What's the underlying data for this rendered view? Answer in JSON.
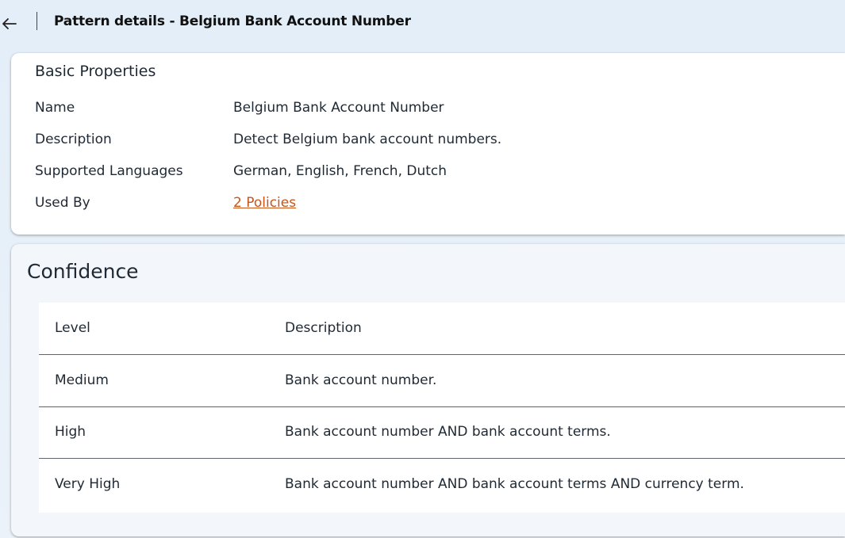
{
  "header": {
    "title": "Pattern details - Belgium Bank Account Number"
  },
  "basic": {
    "title": "Basic Properties",
    "rows": [
      {
        "label": "Name",
        "value": "Belgium Bank Account Number"
      },
      {
        "label": "Description",
        "value": "Detect Belgium bank account numbers."
      },
      {
        "label": "Supported Languages",
        "value": "German, English, French, Dutch"
      },
      {
        "label": "Used By",
        "value": "2 Policies"
      }
    ]
  },
  "confidence": {
    "title": "Confidence",
    "columns": {
      "level": "Level",
      "description": "Description"
    },
    "rows": [
      {
        "level": "Medium",
        "description": "Bank account number."
      },
      {
        "level": "High",
        "description": "Bank account number AND bank account terms."
      },
      {
        "level": "Very High",
        "description": "Bank account number AND bank account terms AND currency term."
      }
    ]
  },
  "colors": {
    "link": "#c8541a",
    "background": "#e3eef8"
  }
}
